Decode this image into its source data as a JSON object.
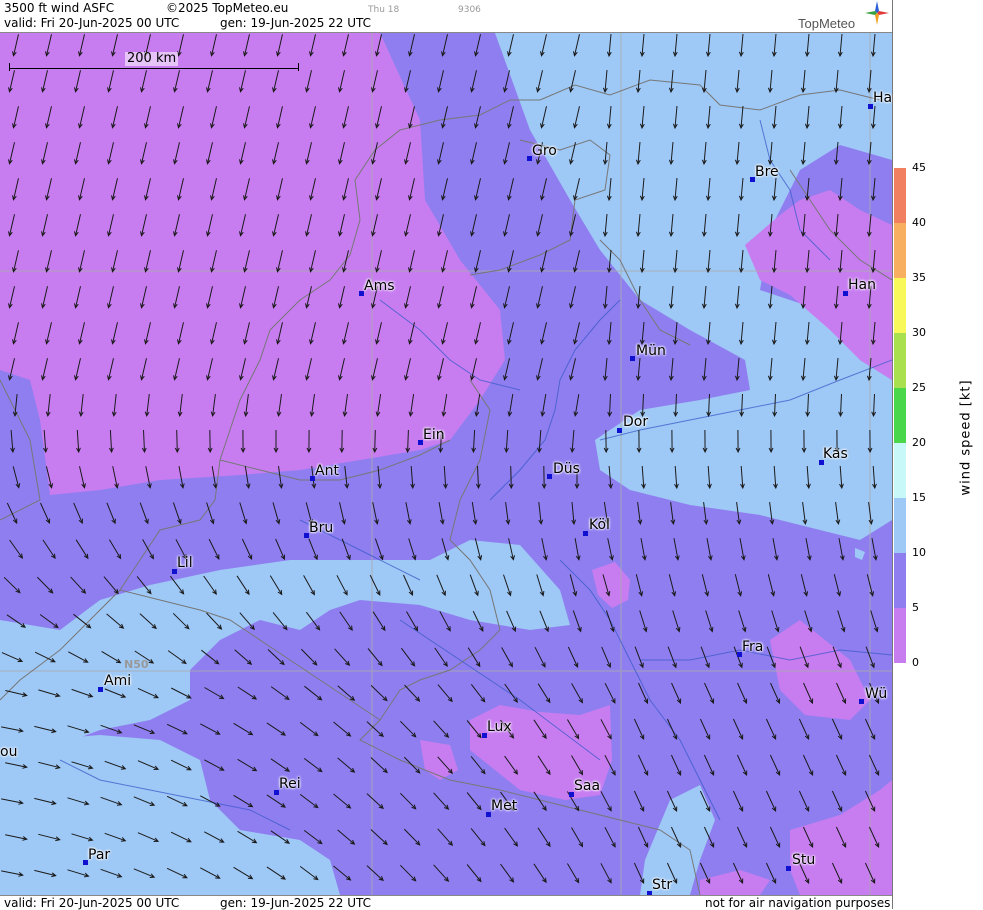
{
  "header": {
    "product": "3500 ft wind ASFC",
    "copyright": "©2025 TopMeteo.eu",
    "run_day": "Thu 18",
    "run_code": "9306",
    "valid": "valid:  Fri  20-Jun-2025  00 UTC",
    "generated": "gen: 19-Jun-2025 22 UTC",
    "logo": "TopMeteo"
  },
  "footer": {
    "valid": "valid:  Fri  20-Jun-2025  00 UTC",
    "generated": "gen: 19-Jun-2025 22 UTC",
    "disclaimer": "not for air navigation purposes"
  },
  "scale_bar": "200 km",
  "grid_label": "N50",
  "colorbar": {
    "label": "wind  speed  [kt]",
    "ticks": [
      "45",
      "40",
      "35",
      "30",
      "25",
      "20",
      "15",
      "10",
      "5",
      "0"
    ],
    "colors": {
      "0-5": "#c77df0",
      "5-10": "#8f7ef0",
      "10-15": "#9ec8f5",
      "15-20": "#c8f8f8",
      "20-25": "#4ad84a",
      "25-30": "#a8e050",
      "30-35": "#f8f85a",
      "35-40": "#f8b060",
      "40-45": "#f08060"
    }
  },
  "cities": [
    {
      "name": "Ha"
    },
    {
      "name": "Gro"
    },
    {
      "name": "Bre"
    },
    {
      "name": "Han"
    },
    {
      "name": "Ams"
    },
    {
      "name": "Mün"
    },
    {
      "name": "Dor"
    },
    {
      "name": "Ein"
    },
    {
      "name": "Kas"
    },
    {
      "name": "Ant"
    },
    {
      "name": "Düs"
    },
    {
      "name": "Bru"
    },
    {
      "name": "Köl"
    },
    {
      "name": "Lil"
    },
    {
      "name": "Fra"
    },
    {
      "name": "Ami"
    },
    {
      "name": "Wü"
    },
    {
      "name": "Lux"
    },
    {
      "name": "ou"
    },
    {
      "name": "Rei"
    },
    {
      "name": "Saa"
    },
    {
      "name": "Met"
    },
    {
      "name": "Par"
    },
    {
      "name": "Stu"
    },
    {
      "name": "Str"
    }
  ]
}
